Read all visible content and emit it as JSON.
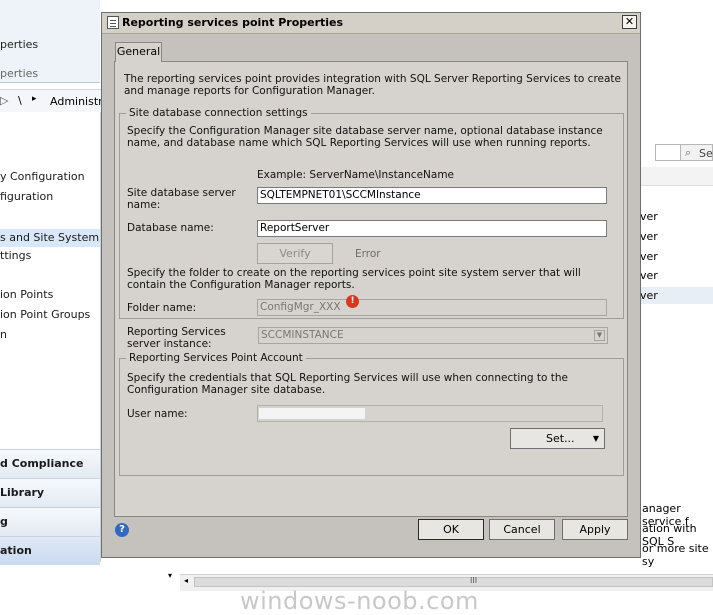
{
  "background": {
    "ribbon": {
      "label1": "perties",
      "label2": "perties"
    },
    "breadcrumb": {
      "arrow": "▸",
      "sep": "\\",
      "text": "Administrat"
    },
    "nav_items": [
      {
        "label": "y Configuration"
      },
      {
        "label": "figuration"
      },
      {
        "label": "s and Site System Rol"
      },
      {
        "label": "ttings"
      },
      {
        "label": "ion Points"
      },
      {
        "label": "ion Point Groups"
      },
      {
        "label": "n"
      }
    ],
    "workspaces": [
      {
        "label": "d Compliance"
      },
      {
        "label": "Library"
      },
      {
        "label": "g"
      },
      {
        "label": "ation"
      }
    ],
    "search_label": "Se",
    "right_items": [
      "ver",
      "ver",
      "ver",
      "ver",
      "ver"
    ],
    "bottom_snippets": [
      "anager service f",
      "ation with SQL S",
      "or more site sy"
    ],
    "scroll_grip": "III",
    "watermark": "windows-noob.com"
  },
  "dialog": {
    "title": "Reporting services point Properties",
    "close": "✕",
    "tab_label": "General",
    "intro": "The reporting services point provides integration with SQL Server Reporting Services to create and manage reports for Configuration Manager.",
    "site_db": {
      "legend": "Site database connection settings",
      "desc": "Specify the Configuration Manager site database server name, optional database instance name, and database name which SQL Reporting Services will use when running reports.",
      "example": "Example: ServerName\\InstanceName",
      "server_label": "Site database server name:",
      "server_value": "SQLTEMPNET01\\SCCMInstance",
      "db_label": "Database name:",
      "db_value": "ReportServer",
      "verify_label": "Verify",
      "error_label": "Error",
      "folder_desc": "Specify the folder to create on the reporting services point site system server that will contain the Configuration Manager reports.",
      "folder_label": "Folder name:",
      "folder_value": "ConfigMgr_XXX"
    },
    "instance_label": "Reporting Services server instance:",
    "instance_value": "SCCMINSTANCE",
    "account": {
      "legend": "Reporting Services Point Account",
      "desc": "Specify the credentials that SQL Reporting Services will use when connecting to the Configuration Manager site database.",
      "user_label": "User name:",
      "user_value": "",
      "set_label": "Set..."
    },
    "buttons": {
      "ok": "OK",
      "cancel": "Cancel",
      "apply": "Apply"
    },
    "help": "?"
  }
}
